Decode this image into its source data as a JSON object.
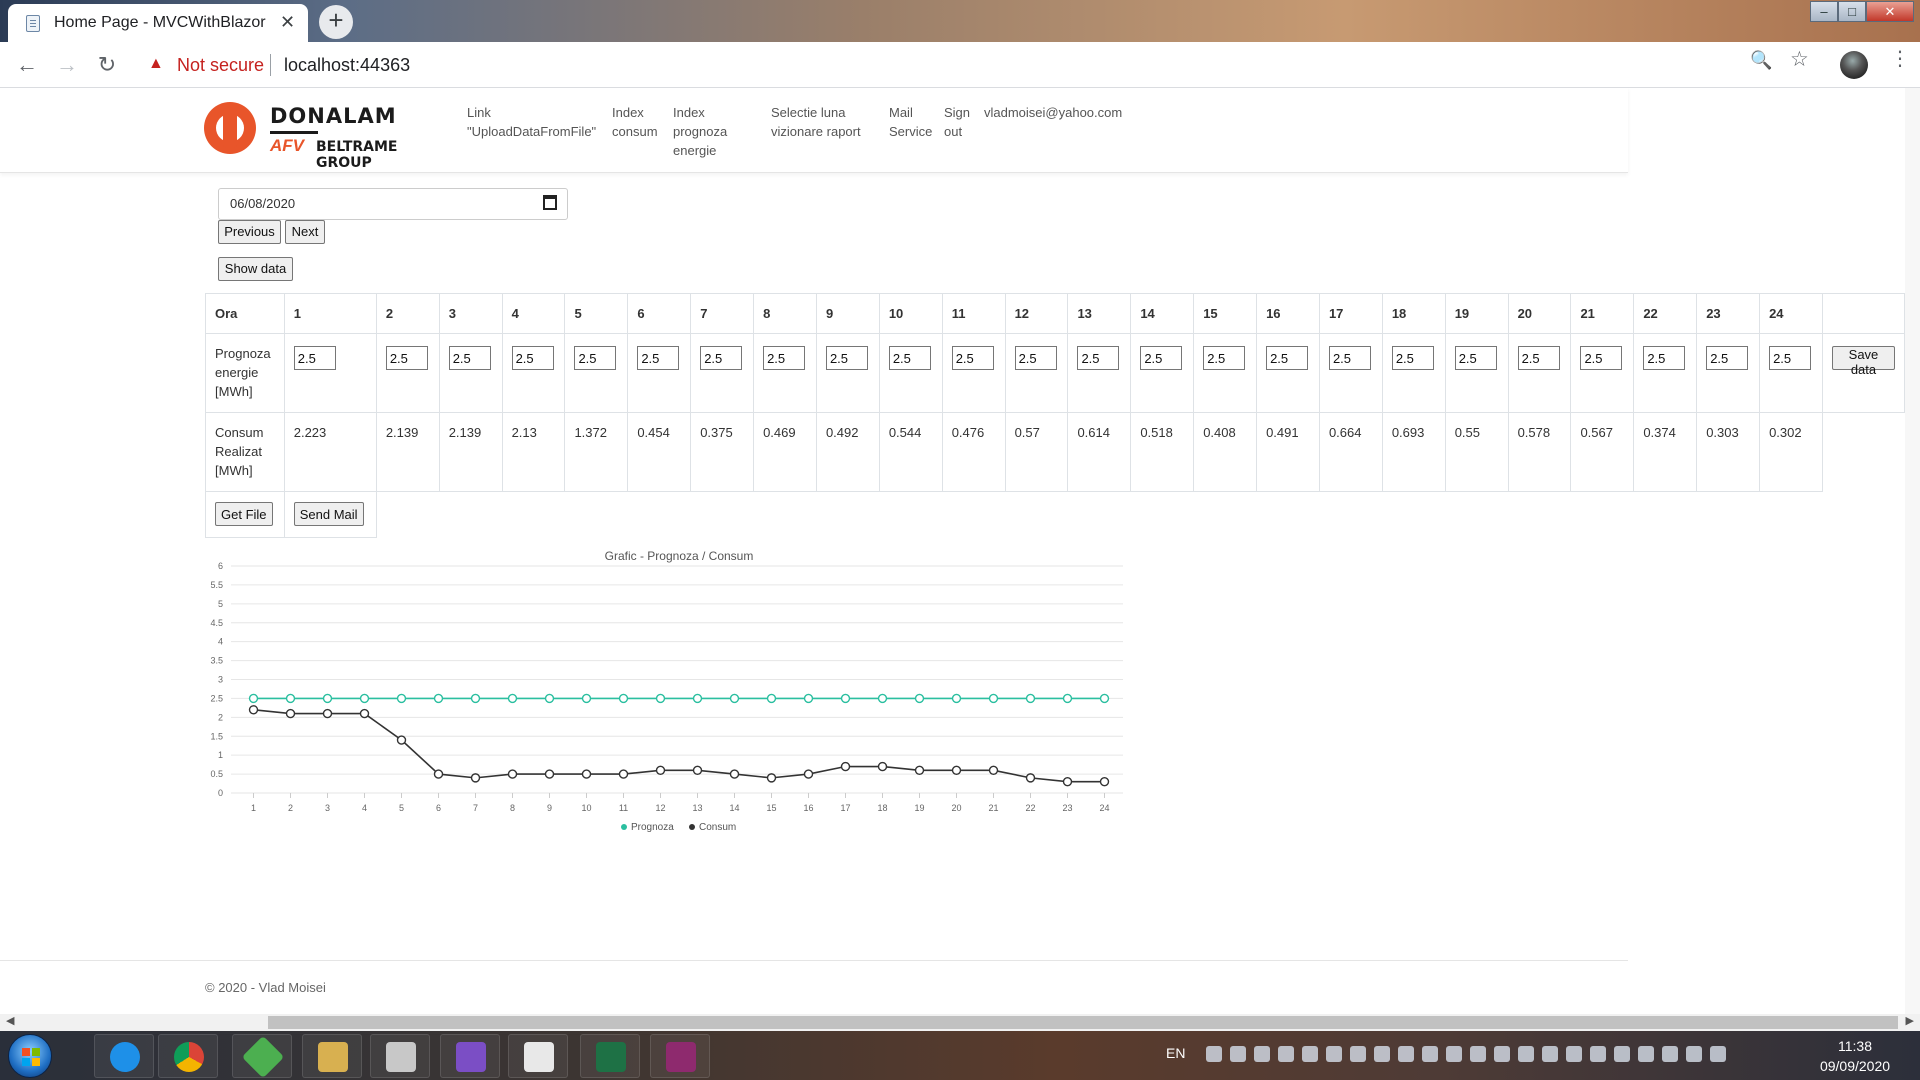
{
  "browser": {
    "tab_title": "Home Page - MVCWithBlazor",
    "tab_close": "✕",
    "new_tab": "+",
    "not_secure": "Not secure",
    "url": "localhost:44363"
  },
  "nav": {
    "brand_name": "DONALAM",
    "brand_afv": "AFV",
    "brand_group": "BELTRAME GROUP",
    "links": [
      "Link\n\"UploadDataFromFile\"",
      "Index\nconsum",
      "Index\nprognoza\nenergie",
      "Selectie luna\nvizionare raport",
      "Mail\nService",
      "Sign\nout"
    ],
    "user_email": "vladmoisei@yahoo.com"
  },
  "controls": {
    "date_value": "06/08/2020",
    "previous_label": "Previous",
    "next_label": "Next",
    "show_data_label": "Show data"
  },
  "table": {
    "header_label": "Ora",
    "hours": [
      "1",
      "2",
      "3",
      "4",
      "5",
      "6",
      "7",
      "8",
      "9",
      "10",
      "11",
      "12",
      "13",
      "14",
      "15",
      "16",
      "17",
      "18",
      "19",
      "20",
      "21",
      "22",
      "23",
      "24"
    ],
    "prognoza_label": "Prognoza\nenergie\n[MWh]",
    "prognoza_values": [
      "2.5",
      "2.5",
      "2.5",
      "2.5",
      "2.5",
      "2.5",
      "2.5",
      "2.5",
      "2.5",
      "2.5",
      "2.5",
      "2.5",
      "2.5",
      "2.5",
      "2.5",
      "2.5",
      "2.5",
      "2.5",
      "2.5",
      "2.5",
      "2.5",
      "2.5",
      "2.5",
      "2.5"
    ],
    "consum_label": "Consum\nRealizat\n[MWh]",
    "consum_values": [
      "2.223",
      "2.139",
      "2.139",
      "2.13",
      "1.372",
      "0.454",
      "0.375",
      "0.469",
      "0.492",
      "0.544",
      "0.476",
      "0.57",
      "0.614",
      "0.518",
      "0.408",
      "0.491",
      "0.664",
      "0.693",
      "0.55",
      "0.578",
      "0.567",
      "0.374",
      "0.303",
      "0.302"
    ],
    "save_label": "Save data",
    "get_file_label": "Get File",
    "send_mail_label": "Send Mail"
  },
  "chart_data": {
    "type": "line",
    "title": "Grafic - Prognoza / Consum",
    "x": [
      1,
      2,
      3,
      4,
      5,
      6,
      7,
      8,
      9,
      10,
      11,
      12,
      13,
      14,
      15,
      16,
      17,
      18,
      19,
      20,
      21,
      22,
      23,
      24
    ],
    "y_ticks": [
      "0",
      "0.5",
      "1",
      "1.5",
      "2",
      "2.5",
      "3",
      "3.5",
      "4",
      "4.5",
      "5",
      "5.5",
      "6"
    ],
    "ylim": [
      0,
      6
    ],
    "grid": true,
    "legend": "bottom",
    "series": [
      {
        "name": "Prognoza",
        "color": "#2bbfa0",
        "values": [
          2.5,
          2.5,
          2.5,
          2.5,
          2.5,
          2.5,
          2.5,
          2.5,
          2.5,
          2.5,
          2.5,
          2.5,
          2.5,
          2.5,
          2.5,
          2.5,
          2.5,
          2.5,
          2.5,
          2.5,
          2.5,
          2.5,
          2.5,
          2.5
        ]
      },
      {
        "name": "Consum",
        "color": "#333333",
        "values": [
          2.2,
          2.1,
          2.1,
          2.1,
          1.4,
          0.5,
          0.4,
          0.5,
          0.5,
          0.5,
          0.5,
          0.6,
          0.6,
          0.5,
          0.4,
          0.5,
          0.7,
          0.7,
          0.6,
          0.6,
          0.6,
          0.4,
          0.3,
          0.3
        ]
      }
    ]
  },
  "footer": {
    "text": "© 2020 - Vlad Moisei"
  },
  "taskbar": {
    "language": "EN",
    "time": "11:38",
    "date": "09/09/2020"
  }
}
